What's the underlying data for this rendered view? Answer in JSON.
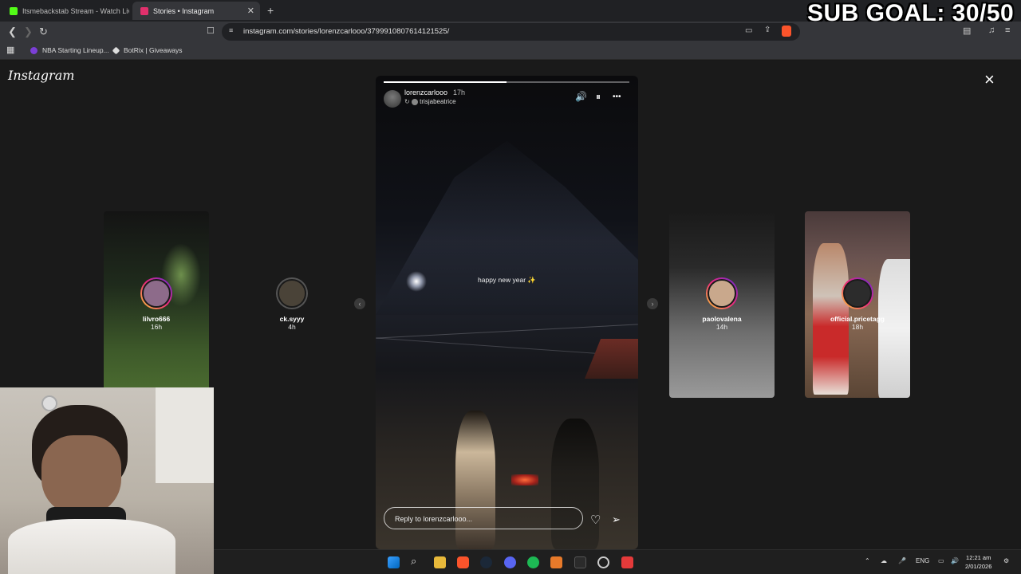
{
  "overlay": {
    "sub_goal": "SUB GOAL: 30/50"
  },
  "browser": {
    "tabs": [
      {
        "title": "Itsmebackstab Stream - Watch Live o",
        "favicon_color": "#53fc18"
      },
      {
        "title": "Stories • Instagram",
        "favicon_color": "#e1306c"
      }
    ],
    "url": "instagram.com/stories/lorenzcarlooo/3799910807614121525/",
    "bookmarks": [
      {
        "label": "NBA Starting Lineup...",
        "color": "#7b3fd6"
      },
      {
        "label": "BotRix | Giveaways",
        "color": "#dddddd"
      }
    ]
  },
  "instagram": {
    "logo": "Instagram",
    "close_icon": "×",
    "story": {
      "username": "lorenzcarlooo",
      "time": "17h",
      "reposted_from": "trisjabeatrice",
      "progress": 0.5,
      "caption": "happy new year ✨",
      "reply_placeholder": "Reply to lorenzcarlooo...",
      "controls": {
        "sound": "🔊",
        "pause": "⏸",
        "more": "•••"
      },
      "heart": "♡",
      "send": "➢"
    },
    "side_stories": [
      {
        "name": "lilvro666",
        "ago": "16h"
      },
      {
        "name": "ck.syyy",
        "ago": "4h"
      },
      {
        "name": "paolovalena",
        "ago": "14h"
      },
      {
        "name": "official.pricetagg",
        "ago": "18h"
      }
    ],
    "prev_arrow": "‹",
    "next_arrow": "›"
  },
  "taskbar": {
    "tray": {
      "lang": "ENG"
    },
    "clock": {
      "time": "12:21 am",
      "date": "2/01/2026"
    }
  }
}
